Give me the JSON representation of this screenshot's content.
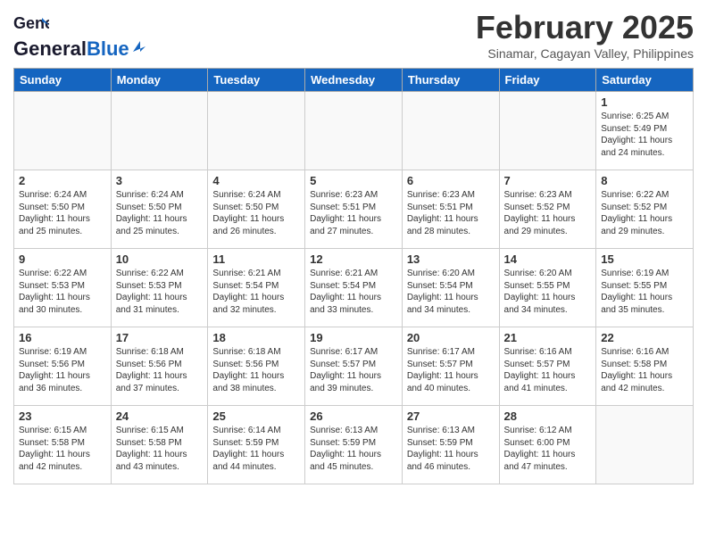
{
  "header": {
    "logo_general": "General",
    "logo_blue": "Blue",
    "month_title": "February 2025",
    "subtitle": "Sinamar, Cagayan Valley, Philippines"
  },
  "weekdays": [
    "Sunday",
    "Monday",
    "Tuesday",
    "Wednesday",
    "Thursday",
    "Friday",
    "Saturday"
  ],
  "weeks": [
    [
      {
        "day": "",
        "info": "",
        "empty": true
      },
      {
        "day": "",
        "info": "",
        "empty": true
      },
      {
        "day": "",
        "info": "",
        "empty": true
      },
      {
        "day": "",
        "info": "",
        "empty": true
      },
      {
        "day": "",
        "info": "",
        "empty": true
      },
      {
        "day": "",
        "info": "",
        "empty": true
      },
      {
        "day": "1",
        "info": "Sunrise: 6:25 AM\nSunset: 5:49 PM\nDaylight: 11 hours and 24 minutes."
      }
    ],
    [
      {
        "day": "2",
        "info": "Sunrise: 6:24 AM\nSunset: 5:50 PM\nDaylight: 11 hours and 25 minutes."
      },
      {
        "day": "3",
        "info": "Sunrise: 6:24 AM\nSunset: 5:50 PM\nDaylight: 11 hours and 25 minutes."
      },
      {
        "day": "4",
        "info": "Sunrise: 6:24 AM\nSunset: 5:50 PM\nDaylight: 11 hours and 26 minutes."
      },
      {
        "day": "5",
        "info": "Sunrise: 6:23 AM\nSunset: 5:51 PM\nDaylight: 11 hours and 27 minutes."
      },
      {
        "day": "6",
        "info": "Sunrise: 6:23 AM\nSunset: 5:51 PM\nDaylight: 11 hours and 28 minutes."
      },
      {
        "day": "7",
        "info": "Sunrise: 6:23 AM\nSunset: 5:52 PM\nDaylight: 11 hours and 29 minutes."
      },
      {
        "day": "8",
        "info": "Sunrise: 6:22 AM\nSunset: 5:52 PM\nDaylight: 11 hours and 29 minutes."
      }
    ],
    [
      {
        "day": "9",
        "info": "Sunrise: 6:22 AM\nSunset: 5:53 PM\nDaylight: 11 hours and 30 minutes."
      },
      {
        "day": "10",
        "info": "Sunrise: 6:22 AM\nSunset: 5:53 PM\nDaylight: 11 hours and 31 minutes."
      },
      {
        "day": "11",
        "info": "Sunrise: 6:21 AM\nSunset: 5:54 PM\nDaylight: 11 hours and 32 minutes."
      },
      {
        "day": "12",
        "info": "Sunrise: 6:21 AM\nSunset: 5:54 PM\nDaylight: 11 hours and 33 minutes."
      },
      {
        "day": "13",
        "info": "Sunrise: 6:20 AM\nSunset: 5:54 PM\nDaylight: 11 hours and 34 minutes."
      },
      {
        "day": "14",
        "info": "Sunrise: 6:20 AM\nSunset: 5:55 PM\nDaylight: 11 hours and 34 minutes."
      },
      {
        "day": "15",
        "info": "Sunrise: 6:19 AM\nSunset: 5:55 PM\nDaylight: 11 hours and 35 minutes."
      }
    ],
    [
      {
        "day": "16",
        "info": "Sunrise: 6:19 AM\nSunset: 5:56 PM\nDaylight: 11 hours and 36 minutes."
      },
      {
        "day": "17",
        "info": "Sunrise: 6:18 AM\nSunset: 5:56 PM\nDaylight: 11 hours and 37 minutes."
      },
      {
        "day": "18",
        "info": "Sunrise: 6:18 AM\nSunset: 5:56 PM\nDaylight: 11 hours and 38 minutes."
      },
      {
        "day": "19",
        "info": "Sunrise: 6:17 AM\nSunset: 5:57 PM\nDaylight: 11 hours and 39 minutes."
      },
      {
        "day": "20",
        "info": "Sunrise: 6:17 AM\nSunset: 5:57 PM\nDaylight: 11 hours and 40 minutes."
      },
      {
        "day": "21",
        "info": "Sunrise: 6:16 AM\nSunset: 5:57 PM\nDaylight: 11 hours and 41 minutes."
      },
      {
        "day": "22",
        "info": "Sunrise: 6:16 AM\nSunset: 5:58 PM\nDaylight: 11 hours and 42 minutes."
      }
    ],
    [
      {
        "day": "23",
        "info": "Sunrise: 6:15 AM\nSunset: 5:58 PM\nDaylight: 11 hours and 42 minutes."
      },
      {
        "day": "24",
        "info": "Sunrise: 6:15 AM\nSunset: 5:58 PM\nDaylight: 11 hours and 43 minutes."
      },
      {
        "day": "25",
        "info": "Sunrise: 6:14 AM\nSunset: 5:59 PM\nDaylight: 11 hours and 44 minutes."
      },
      {
        "day": "26",
        "info": "Sunrise: 6:13 AM\nSunset: 5:59 PM\nDaylight: 11 hours and 45 minutes."
      },
      {
        "day": "27",
        "info": "Sunrise: 6:13 AM\nSunset: 5:59 PM\nDaylight: 11 hours and 46 minutes."
      },
      {
        "day": "28",
        "info": "Sunrise: 6:12 AM\nSunset: 6:00 PM\nDaylight: 11 hours and 47 minutes."
      },
      {
        "day": "",
        "info": "",
        "empty": true
      }
    ]
  ]
}
